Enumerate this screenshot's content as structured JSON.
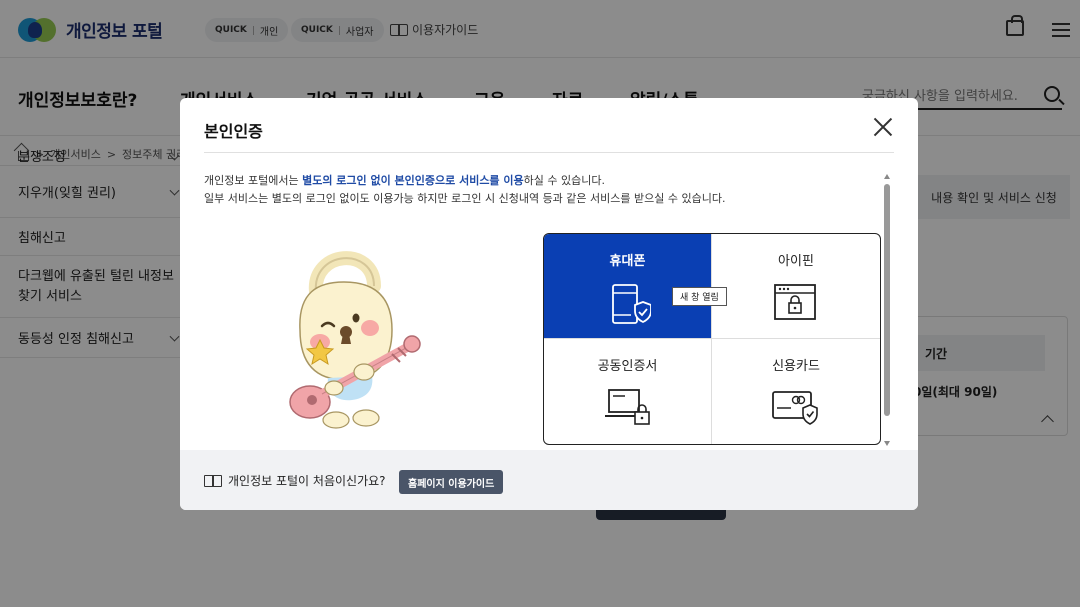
{
  "header": {
    "logo_text": "개인정보 포털",
    "quick_personal": {
      "badge": "QUICK",
      "label": "개인"
    },
    "quick_business": {
      "badge": "QUICK",
      "label": "사업자"
    },
    "user_guide": "이용자가이드"
  },
  "gnb": {
    "title": "개인정보보호란?",
    "items": [
      "개인서비스",
      "기업·공공 서비스",
      "교육",
      "자료",
      "알림/소통"
    ],
    "search_placeholder": "궁금하신 사항을 입력하세요."
  },
  "breadcrumb": [
    "개인서비스",
    "정보주체 권리행"
  ],
  "lnb": {
    "items": [
      {
        "label": "분쟁조정"
      },
      {
        "label": "지우개(잊힐 권리)"
      },
      {
        "label": "침해신고"
      },
      {
        "label": "다크웹에 유출된 털린 내정보찾기 서비스"
      },
      {
        "label": "동등성 인정 침해신고"
      }
    ]
  },
  "right": {
    "tab_label": "내용 확인 및 서비스 신청",
    "panel_header": "기간",
    "panel_value": "0일(최대 90일)"
  },
  "modal": {
    "title": "본인인증",
    "desc1_pre": "개인정보 포털에서는 ",
    "desc1_hl": "별도의 로그인 없이 본인인증으로 서비스를 이용",
    "desc1_post": "하실 수 있습니다.",
    "desc2": "일부 서비스는 별도의 로그인 없이도 이용가능 하지만 로그인 시 신청내역 등과 같은 서비스를 받으실 수 있습니다.",
    "options": [
      {
        "label": "휴대폰",
        "icon": "mobile-phone-icon",
        "active": true
      },
      {
        "label": "아이핀",
        "icon": "ipin-browser-lock-icon",
        "active": false
      },
      {
        "label": "공동인증서",
        "icon": "certificate-laptop-icon",
        "active": false
      },
      {
        "label": "신용카드",
        "icon": "credit-card-icon",
        "active": false
      }
    ],
    "tooltip": "새 창 열림",
    "footer_text": "개인정보 포털이 처음이신가요?",
    "footer_button": "홈페이지 이용가이드"
  },
  "colors": {
    "primary": "#0a3fb3",
    "highlight_text": "#1f4ba5",
    "footer_bg": "#f1f2f4",
    "guide_button": "#4a5568"
  }
}
